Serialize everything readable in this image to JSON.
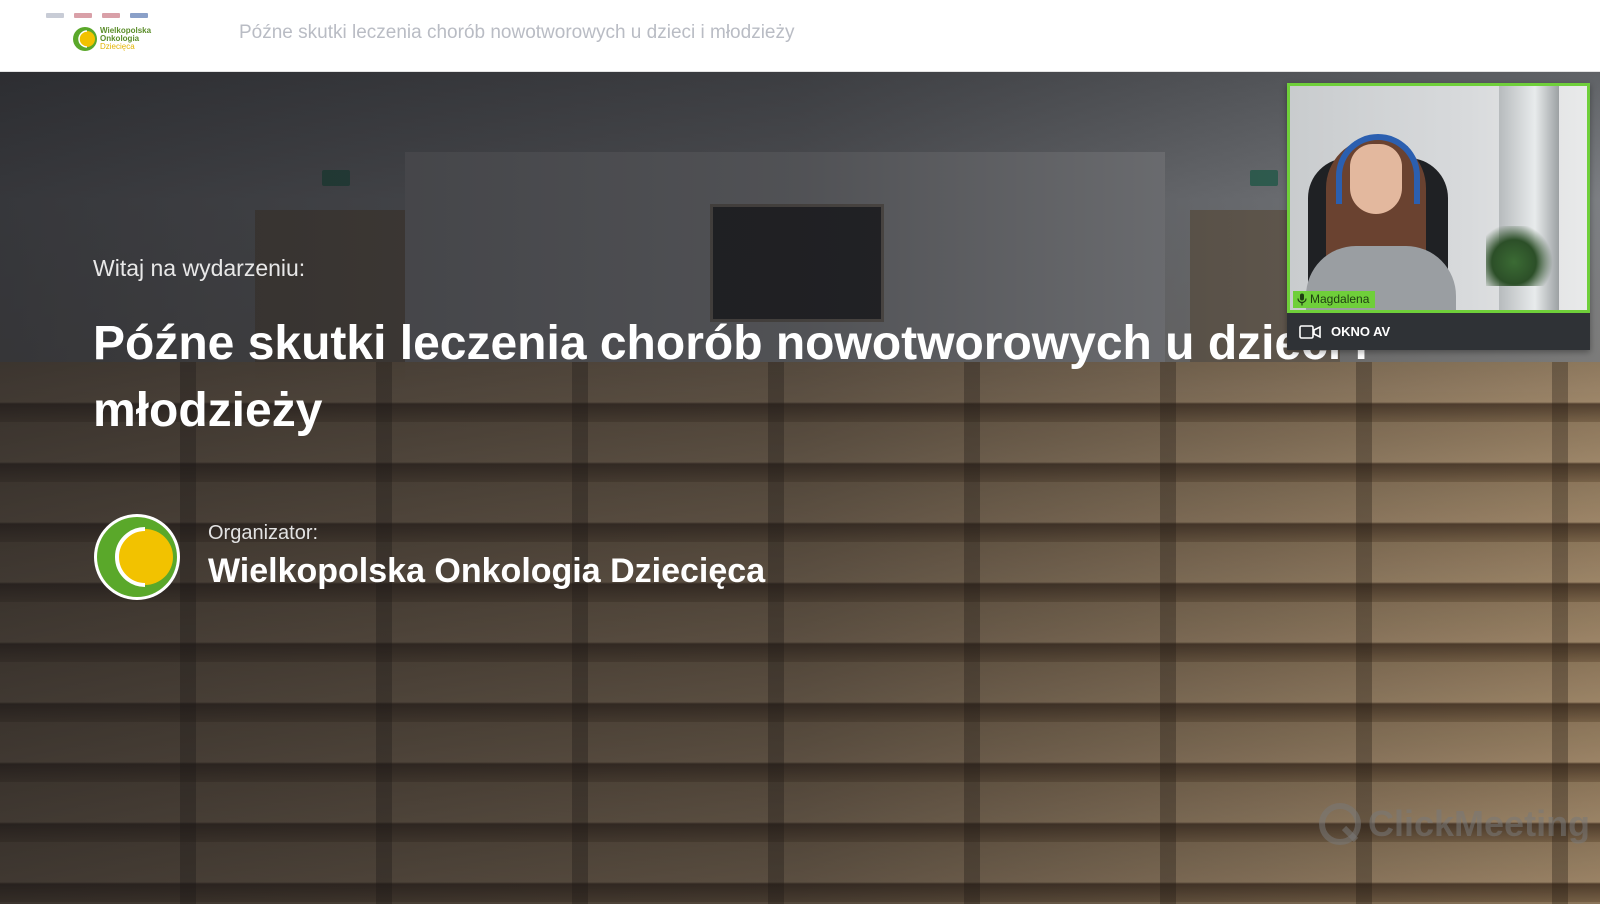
{
  "header": {
    "page_title": "Późne skutki leczenia chorób nowotworowych u dzieci i młodzieży",
    "logo": {
      "line1": "Wielkopolska",
      "line2": "Onkologia",
      "line3": "Dziecięca"
    }
  },
  "event": {
    "welcome_label": "Witaj na wydarzeniu:",
    "title": "Późne skutki leczenia chorób nowotworowych u dzieci i młodzieży",
    "organizer_label": "Organizator:",
    "organizer_name": "Wielkopolska Onkologia Dziecięca"
  },
  "av_window": {
    "participant_name": "Magdalena",
    "label": "OKNO AV",
    "mic_icon": "microphone-icon",
    "camera_icon": "camera-icon"
  },
  "watermark": {
    "brand": "ClickMeeting"
  },
  "colors": {
    "accent_green": "#6fcf3a",
    "logo_green": "#5aa82a",
    "logo_yellow": "#f2c200"
  }
}
